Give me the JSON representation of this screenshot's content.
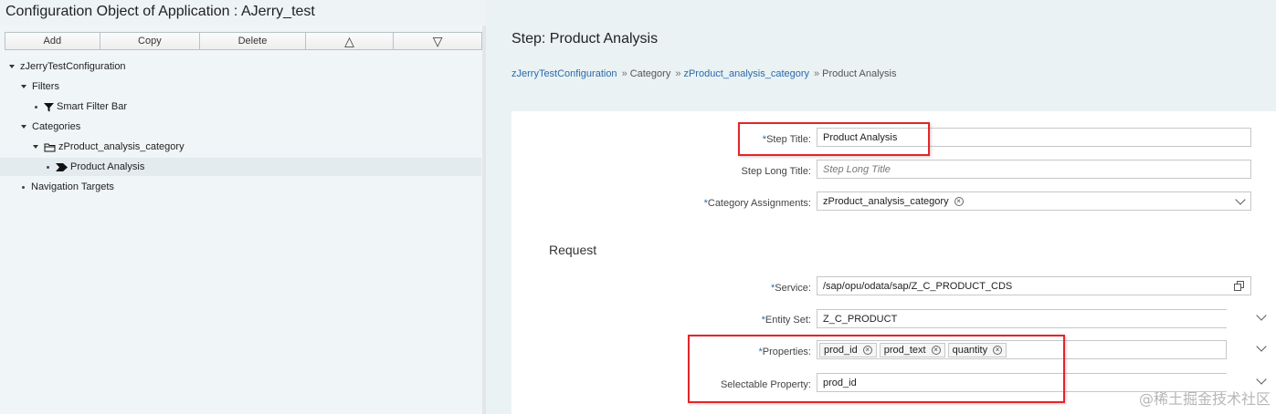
{
  "app": {
    "title": "Configuration Object of Application : AJerry_test"
  },
  "toolbar": {
    "add": "Add",
    "copy": "Copy",
    "delete": "Delete",
    "up": "△",
    "down": "▽"
  },
  "tree": {
    "root": "zJerryTestConfiguration",
    "filters": "Filters",
    "smart_filter_bar": "Smart Filter Bar",
    "categories": "Categories",
    "category_item": "zProduct_analysis_category",
    "step_item": "Product Analysis",
    "navigation_targets": "Navigation Targets"
  },
  "detail": {
    "title": "Step: Product Analysis",
    "breadcrumb": {
      "root": "zJerryTestConfiguration",
      "category_label": "Category",
      "category_link": "zProduct_analysis_category",
      "current": "Product Analysis",
      "separator": "»"
    },
    "required_mark": "*",
    "fields": {
      "step_title_label": "Step Title:",
      "step_title_value": "Product Analysis",
      "step_long_title_label": "Step Long Title:",
      "step_long_title_placeholder": "Step Long Title",
      "category_assignments_label": "Category Assignments:",
      "category_assignment_token": "zProduct_analysis_category"
    },
    "request": {
      "section_title": "Request",
      "service_label": "Service:",
      "service_value": "/sap/opu/odata/sap/Z_C_PRODUCT_CDS",
      "entity_set_label": "Entity Set:",
      "entity_set_value": "Z_C_PRODUCT",
      "properties_label": "Properties:",
      "properties": [
        "prod_id",
        "prod_text",
        "quantity"
      ],
      "selectable_property_label": "Selectable Property:",
      "selectable_property_value": "prod_id"
    },
    "token_remove_glyph": "×"
  },
  "watermark": "@稀土掘金技术社区",
  "colors": {
    "highlight": "#e0262b",
    "link": "#2b6bab",
    "required": "#2b6bab"
  }
}
